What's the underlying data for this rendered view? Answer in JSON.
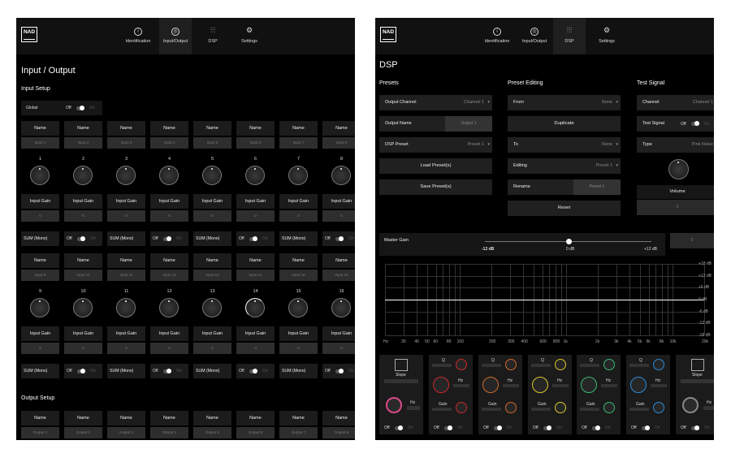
{
  "nav": {
    "logo": "NAD",
    "items": [
      {
        "label": "Identification",
        "icon": "info-icon"
      },
      {
        "label": "Input/Output",
        "icon": "fingerprint-icon"
      },
      {
        "label": "DSP",
        "icon": "sliders-icon"
      },
      {
        "label": "Settings",
        "icon": "gear-icon"
      }
    ]
  },
  "io": {
    "title": "Input / Output",
    "input_setup": "Input Setup",
    "global_label": "Global",
    "off": "Off",
    "on": "On",
    "name_label": "Name",
    "input_gain_label": "Input Gain",
    "sum_label": "SUM (Mono)",
    "row1_names": [
      "Input 1",
      "Input 2",
      "Input 3",
      "Input 4",
      "Input 5",
      "Input 6",
      "Input 7",
      "Input 8"
    ],
    "row1_nums": [
      "1",
      "2",
      "3",
      "4",
      "5",
      "6",
      "7",
      "8"
    ],
    "row1_gains": [
      "0",
      "0",
      "0",
      "0",
      "0",
      "0",
      "0",
      "0"
    ],
    "row2_names": [
      "Input 9",
      "Input 10",
      "Input 11",
      "Input 12",
      "Input 13",
      "Input 14",
      "Input 15",
      "Input 16"
    ],
    "row2_nums": [
      "9",
      "10",
      "11",
      "12",
      "13",
      "14",
      "15",
      "16"
    ],
    "row2_gains": [
      "0",
      "0",
      "0",
      "0",
      "0",
      "-2",
      "0",
      "0"
    ],
    "output_setup": "Output Setup",
    "out_names": [
      "Output 1",
      "Output 2",
      "Output 3",
      "Output 4",
      "Output 5",
      "Output 6",
      "Output 7",
      "Output 8"
    ]
  },
  "dsp": {
    "title": "DSP",
    "presets": "Presets",
    "output_channel": "Output Channel",
    "output_channel_value": "Channel 1",
    "output_name": "Output Name",
    "output_name_value": "Output 1",
    "dsp_preset": "DSP Preset",
    "dsp_preset_value": "Preset 1",
    "load_preset": "Load Preset(s)",
    "save_preset": "Save Preset(s)",
    "preset_editing": "Preset Editing",
    "from": "From",
    "from_value": "None",
    "duplicate": "Duplicate",
    "to": "To",
    "to_value": "None",
    "editing": "Editing",
    "editing_value": "Preset 1",
    "rename": "Rename",
    "rename_value": "Preset 1",
    "reset": "Reset",
    "test_signal_title": "Test Signal",
    "channel": "Channel",
    "channel_value": "Channel 1",
    "test_signal": "Test Signal",
    "type": "Type",
    "type_value": "Pink Noise",
    "volume": "Volume",
    "volume_value": "0",
    "master_gain": "Master Gain",
    "master_gain_value": "0",
    "slider_min": "-12 dB",
    "slider_mid": "0 dB",
    "slider_max": "+12 dB",
    "db_labels": [
      "+18 dB",
      "+12 dB",
      "+6 dB",
      "0 dB",
      "-6 dB",
      "-12 dB",
      "-18 dB"
    ],
    "freq_labels": [
      "Hz",
      "30",
      "40",
      "50",
      "60",
      "80",
      "100",
      "200",
      "300",
      "400",
      "600",
      "800",
      "1k",
      "2k",
      "3k",
      "4k",
      "5k",
      "6k",
      "8k",
      "10k",
      "20k"
    ],
    "slope": "Slope",
    "q": "Q",
    "hz": "Hz",
    "gain": "Gain",
    "band_colors": [
      "#d84a8a",
      "#cc2a2a",
      "#d0682a",
      "#d8c62a",
      "#3ab870",
      "#2a8ad8",
      "#888888"
    ]
  }
}
